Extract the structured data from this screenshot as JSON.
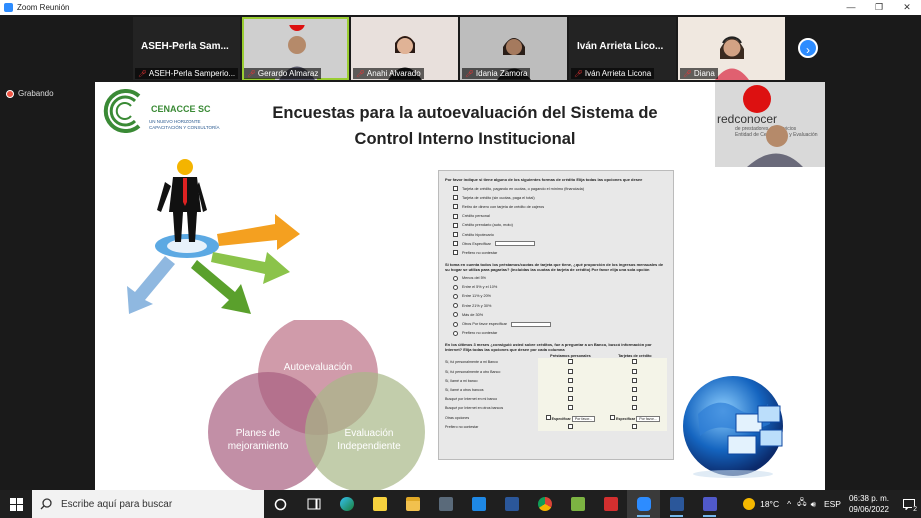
{
  "window": {
    "title": "Zoom Reunión",
    "minimize": "—",
    "maximize": "❐",
    "close": "✕"
  },
  "participants": [
    {
      "big_name": "ASEH-Perla  Sam...",
      "label": "ASEH-Perla Samperio...",
      "muted": true,
      "video": false
    },
    {
      "big_name": "",
      "label": "Gerardo Almaraz",
      "muted": true,
      "video": true,
      "active": true
    },
    {
      "big_name": "",
      "label": "Anahi Alvarado",
      "muted": true,
      "video": true
    },
    {
      "big_name": "",
      "label": "Idania Zamora",
      "muted": true,
      "video": true
    },
    {
      "big_name": "Iván Arrieta  Lico...",
      "label": "Iván Arrieta Licona",
      "muted": true,
      "video": false
    },
    {
      "big_name": "",
      "label": "Diana",
      "muted": true,
      "video": true
    }
  ],
  "next_arrow": "›",
  "recording": "Grabando",
  "slide": {
    "title_line1": "Encuestas para la autoevaluación del Sistema de",
    "title_line2": "Control Interno Institucional",
    "logo_name": "CENACCE SC",
    "logo_tagline1": "UN NUEVO HORIZONTE",
    "logo_tagline2": "CAPACITACIÓN Y CONSULTORÍA",
    "partner_logo": "redconocer",
    "partner_sub": "de prestadores de servicios",
    "partner_sub2": "Entidad de Certificación y Evaluación",
    "venn": {
      "top": "Autoevaluación",
      "left_line1": "Planes de",
      "left_line2": "mejoramiento",
      "right_line1": "Evaluación",
      "right_line2": "Independiente"
    },
    "survey": {
      "q1": "Por favor indique si tiene alguno de los siguientes formas de crédito  Elija todas las opciones que desee",
      "q1_options": [
        "Tarjeta de crédito, pagando en cuotas, o pagando el mínimo (financiada)",
        "Tarjeta de crédito (sin cuotas, paga el total)",
        "Retiro de dinero con tarjeta de crédito de cajeros",
        "Crédito personal",
        "Crédito prendario (auto, moto)",
        "Crédito hipotecario",
        "Otros Especificar",
        "Prefiero no contestar"
      ],
      "q2": "Si toma en cuenta todos los préstamos/cuotas de tarjeta que tiene, ¿qué proporción de los ingresos mensuales de su hogar se utiliza para pagarlas? (incluidas las cuotas de tarjeta de crédito) Por favor elija una sola opción",
      "q2_options": [
        "Menos del 5%",
        "Entre el 5% y el 10%",
        "Entre 11% y 20%",
        "Entre 21% y 30%",
        "Más de 30%",
        "Otros Por favor especificar",
        "Prefiero no contestar"
      ],
      "q3": "En los últimos 3 meses ¿consiguió usted sobre créditos, fue a preguntar a un Banco, buscó información por Internet? Elija todas las opciones que desee por cada columna",
      "q3_col1": "Préstamos personales",
      "q3_col2": "Tarjetas de crédito",
      "q3_rows": [
        "Sí, fui personalmente a mi Banco",
        "Sí, fui personalmente a otro Banco",
        "Sí, llamé a mi banco",
        "Sí, llamé a otros bancos",
        "Busqué por Internet en mi banco",
        "Busqué por Internet en otros bancos",
        "Otras opciones",
        "Prefiero no contestar"
      ],
      "q3_specify": "Especificar",
      "q3_placeholder": "Por favor..."
    }
  },
  "taskbar": {
    "search_placeholder": "Escribe aquí para buscar",
    "weather": "18°C",
    "language": "ESP",
    "time": "06:38 p. m.",
    "date": "09/06/2022",
    "notifications": "2"
  }
}
